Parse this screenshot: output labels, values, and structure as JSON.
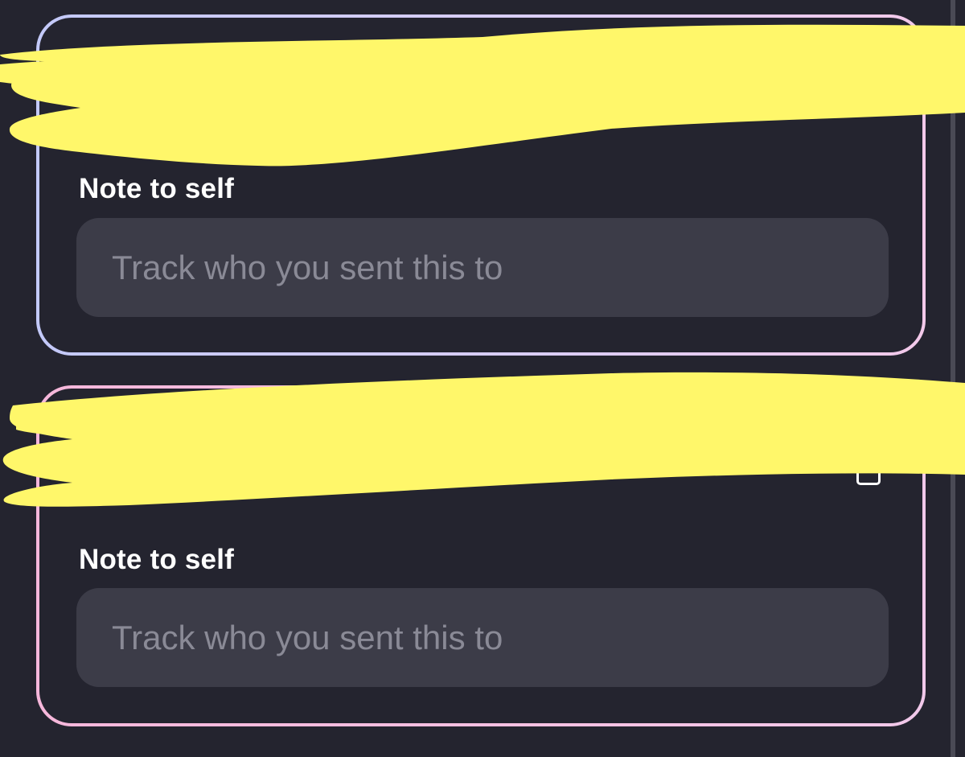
{
  "cards": [
    {
      "label": "Note to self",
      "input_placeholder": "Track who you sent this to",
      "input_value": ""
    },
    {
      "label": "Note to self",
      "input_placeholder": "Track who you sent this to",
      "input_value": ""
    }
  ],
  "colors": {
    "background": "#24242f",
    "input_background": "#3c3c48",
    "label_text": "#ffffff",
    "placeholder_text": "#8a8a96",
    "card1_border": "#c3c9f9",
    "card2_border": "#f6b7db",
    "redaction_marker": "#fff76a"
  }
}
